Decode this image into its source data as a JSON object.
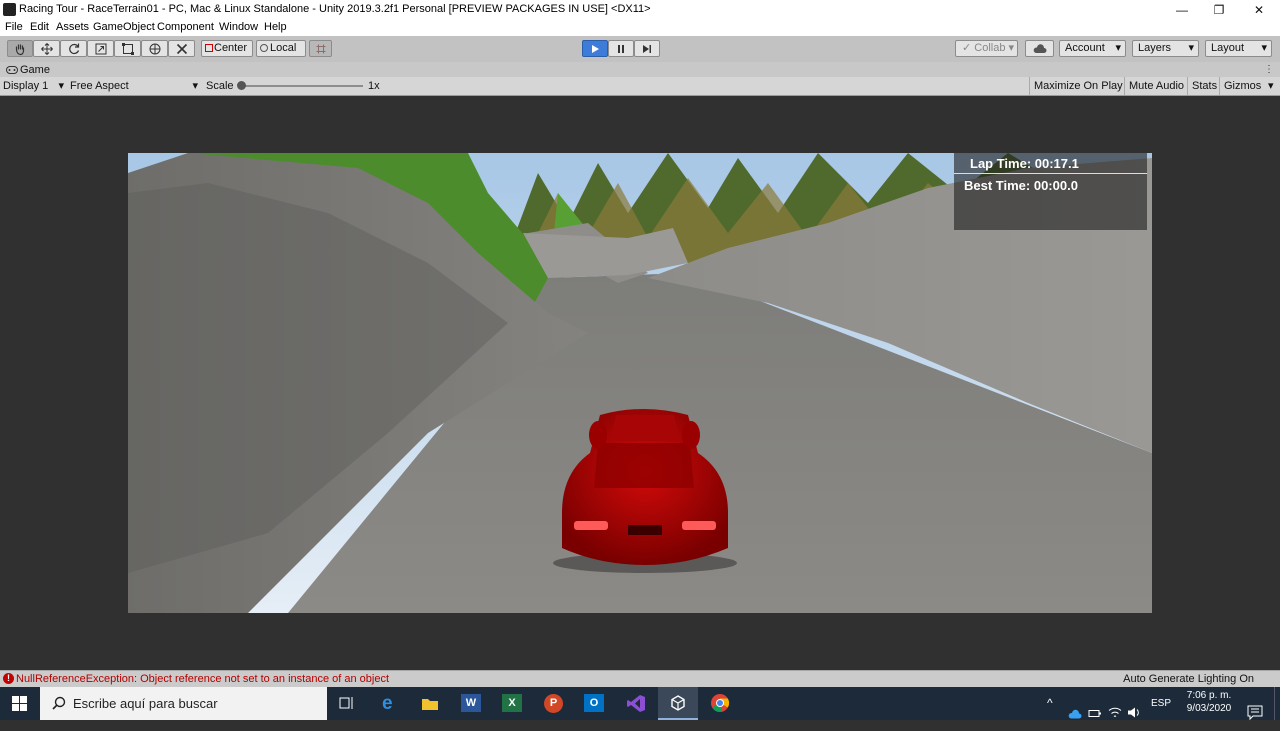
{
  "window": {
    "title": "Racing Tour - RaceTerrain01 - PC, Mac & Linux Standalone - Unity 2019.3.2f1 Personal [PREVIEW PACKAGES IN USE] <DX11>",
    "minimize": "—",
    "maximize": "❐",
    "close": "✕"
  },
  "menu": [
    "File",
    "Edit",
    "Assets",
    "GameObject",
    "Component",
    "Window",
    "Help"
  ],
  "toolbar": {
    "pivot_label": "Center",
    "space_label": "Local",
    "collab_label": "Collab",
    "account_label": "Account",
    "layers_label": "Layers",
    "layout_label": "Layout",
    "dropdown_arrow": "▾"
  },
  "game_tab": {
    "label": "Game"
  },
  "game_bar": {
    "display": "Display 1",
    "aspect": "Free Aspect",
    "scale_label": "Scale",
    "scale_value": "1x",
    "scale_fraction": 0.0,
    "maximize_on_play": "Maximize On Play",
    "mute_audio": "Mute Audio",
    "stats": "Stats",
    "gizmos": "Gizmos",
    "dropdown_arrow": "▾"
  },
  "hud": {
    "lap_time": "Lap Time:  00:17.1",
    "best_time": "Best Time:  00:00.0"
  },
  "status": {
    "error": "NullReferenceException: Object reference not set to an instance of an object",
    "lighting": "Auto Generate Lighting On"
  },
  "taskbar": {
    "search_placeholder": "Escribe aquí para buscar",
    "language": "ESP",
    "time": "7:06 p. m.",
    "date": "9/03/2020"
  },
  "colors": {
    "editor_bg": "#303030",
    "toolbar_bg": "#c2c2c2",
    "play_active": "#3d7dd9",
    "error_text": "#b40000",
    "taskbar_bg": "#1c2a3a",
    "car_red": "#b00000"
  }
}
